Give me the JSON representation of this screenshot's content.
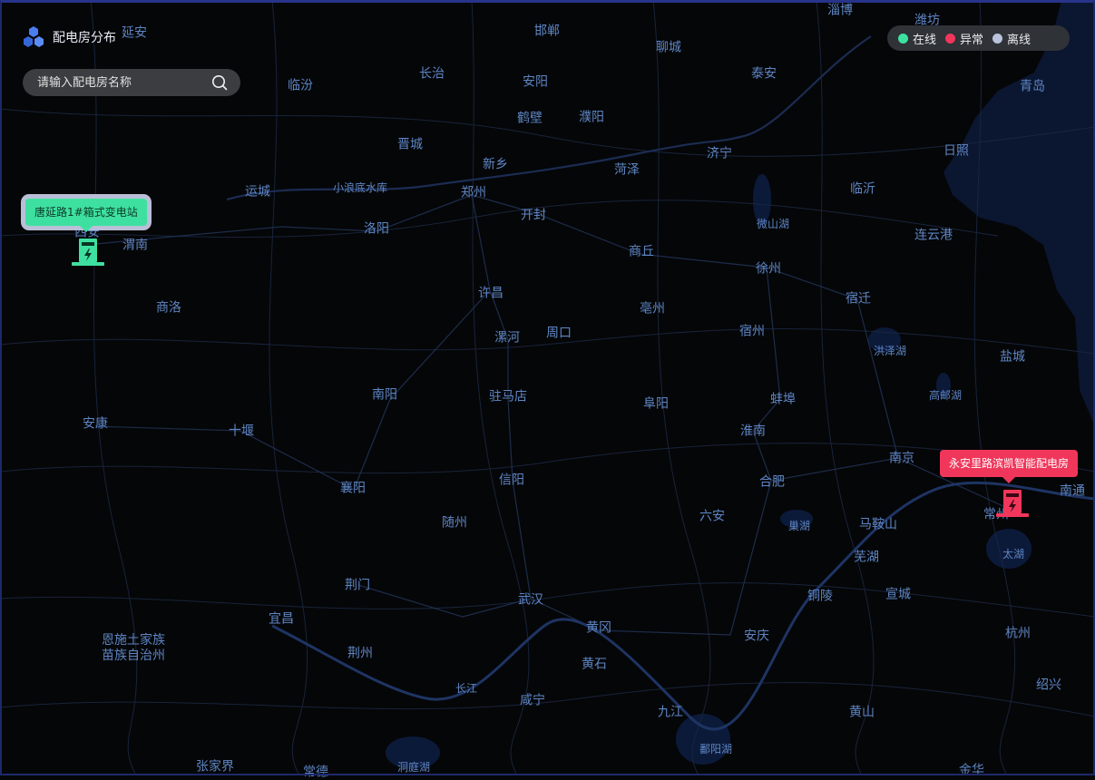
{
  "header": {
    "title": "配电房分布"
  },
  "search": {
    "placeholder": "请输入配电房名称"
  },
  "legend": [
    {
      "label": "在线",
      "color": "#3ee0a0"
    },
    {
      "label": "异常",
      "color": "#f0365a"
    },
    {
      "label": "离线",
      "color": "#b9c3dc"
    }
  ],
  "stations": [
    {
      "name": "唐延路1#箱式变电站",
      "status": "在线",
      "color": "#3ee0a0"
    },
    {
      "name": "永安里路滨凯智能配电房",
      "status": "异常",
      "color": "#f0365a"
    }
  ],
  "cities": [
    "延安",
    "邯郸",
    "淄博",
    "潍坊",
    "聊城",
    "长治",
    "安阳",
    "泰安",
    "临汾",
    "青岛",
    "鹤壁",
    "濮阳",
    "晋城",
    "济宁",
    "日照",
    "新乡",
    "菏泽",
    "运城",
    "小浪底水库",
    "郑州",
    "临沂",
    "开封",
    "洛阳",
    "微山湖",
    "连云港",
    "渭南",
    "商丘",
    "徐州",
    "商洛",
    "许昌",
    "宿迁",
    "亳州",
    "漯河",
    "周口",
    "宿州",
    "洪泽湖",
    "盐城",
    "南阳",
    "驻马店",
    "阜阳",
    "蚌埠",
    "高邮湖",
    "安康",
    "十堰",
    "淮南",
    "南京",
    "信阳",
    "合肥",
    "襄阳",
    "南通",
    "随州",
    "六安",
    "巢湖",
    "马鞍山",
    "常州",
    "太湖",
    "芜湖",
    "荆门",
    "武汉",
    "铜陵",
    "宣城",
    "宜昌",
    "黄冈",
    "恩施土家族\n苗族自治州",
    "安庆",
    "荆州",
    "杭州",
    "黄石",
    "长江",
    "咸宁",
    "绍兴",
    "九江",
    "黄山",
    "鄱阳湖",
    "张家界",
    "洞庭湖",
    "常德",
    "金华",
    "西安"
  ]
}
